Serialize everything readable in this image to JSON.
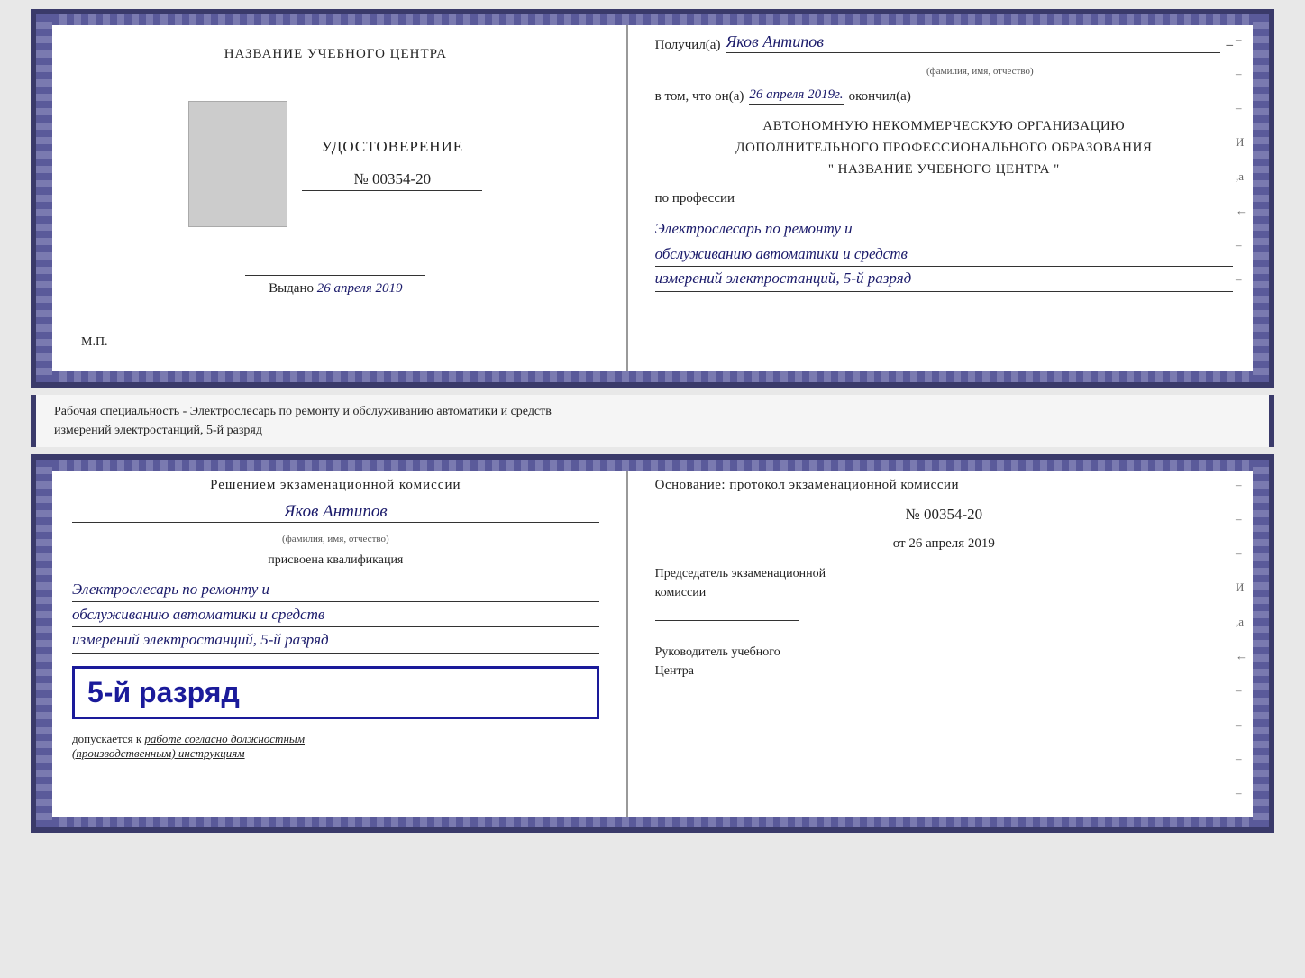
{
  "top_cert": {
    "left": {
      "center_title": "НАЗВАНИЕ УЧЕБНОГО ЦЕНТРА",
      "udostoverenie_label": "УДОСТОВЕРЕНИЕ",
      "number": "№ 00354-20",
      "vydano_label": "Выдано",
      "vydano_date": "26 апреля 2019",
      "mp_label": "М.П."
    },
    "right": {
      "poluchil_label": "Получил(а)",
      "recipient_name": "Яков Антипов",
      "fio_hint": "(фамилия, имя, отчество)",
      "vtom_label": "в том, что он(а)",
      "vtom_date": "26 апреля 2019г.",
      "okonchil_label": "окончил(а)",
      "org_line1": "АВТОНОМНУЮ НЕКОММЕРЧЕСКУЮ ОРГАНИЗАЦИЮ",
      "org_line2": "ДОПОЛНИТЕЛЬНОГО ПРОФЕССИОНАЛЬНОГО ОБРАЗОВАНИЯ",
      "org_quotes": "\"  НАЗВАНИЕ УЧЕБНОГО ЦЕНТРА  \"",
      "po_professii_label": "по профессии",
      "profession_line1": "Электрослесарь по ремонту и",
      "profession_line2": "обслуживанию автоматики и средств",
      "profession_line3": "измерений электростанций, 5-й разряд"
    }
  },
  "info_bar": {
    "text_line1": "Рабочая специальность - Электрослесарь по ремонту и обслуживанию автоматики и средств",
    "text_line2": "измерений электростанций, 5-й разряд"
  },
  "bottom_cert": {
    "left": {
      "resheniem_label": "Решением экзаменационной комиссии",
      "yakov_name": "Яков Антипов",
      "fio_hint": "(фамилия, имя, отчество)",
      "prisvoena_label": "присвоена квалификация",
      "qual_line1": "Электрослесарь по ремонту и",
      "qual_line2": "обслуживанию автоматики и средств",
      "qual_line3": "измерений электростанций, 5-й разряд",
      "rank_badge": "5-й разряд",
      "dopuskaetsya_label": "допускается к",
      "dopuskaetsya_work": "работе согласно должностным",
      "dopuskaetsya_work2": "(производственным) инструкциям"
    },
    "right": {
      "osnovanie_label": "Основание: протокол экзаменационной комиссии",
      "protokol_number": "№ 00354-20",
      "ot_label": "от",
      "protokol_date": "26 апреля 2019",
      "predsedatel_label": "Председатель экзаменационной",
      "kommissii_label": "комиссии",
      "rukovoditel_label": "Руководитель учебного",
      "tsentra_label": "Центра",
      "dashes": [
        "-",
        "-",
        "-",
        "И",
        ",а",
        "←",
        "-",
        "-",
        "-",
        "-",
        "-"
      ]
    }
  }
}
